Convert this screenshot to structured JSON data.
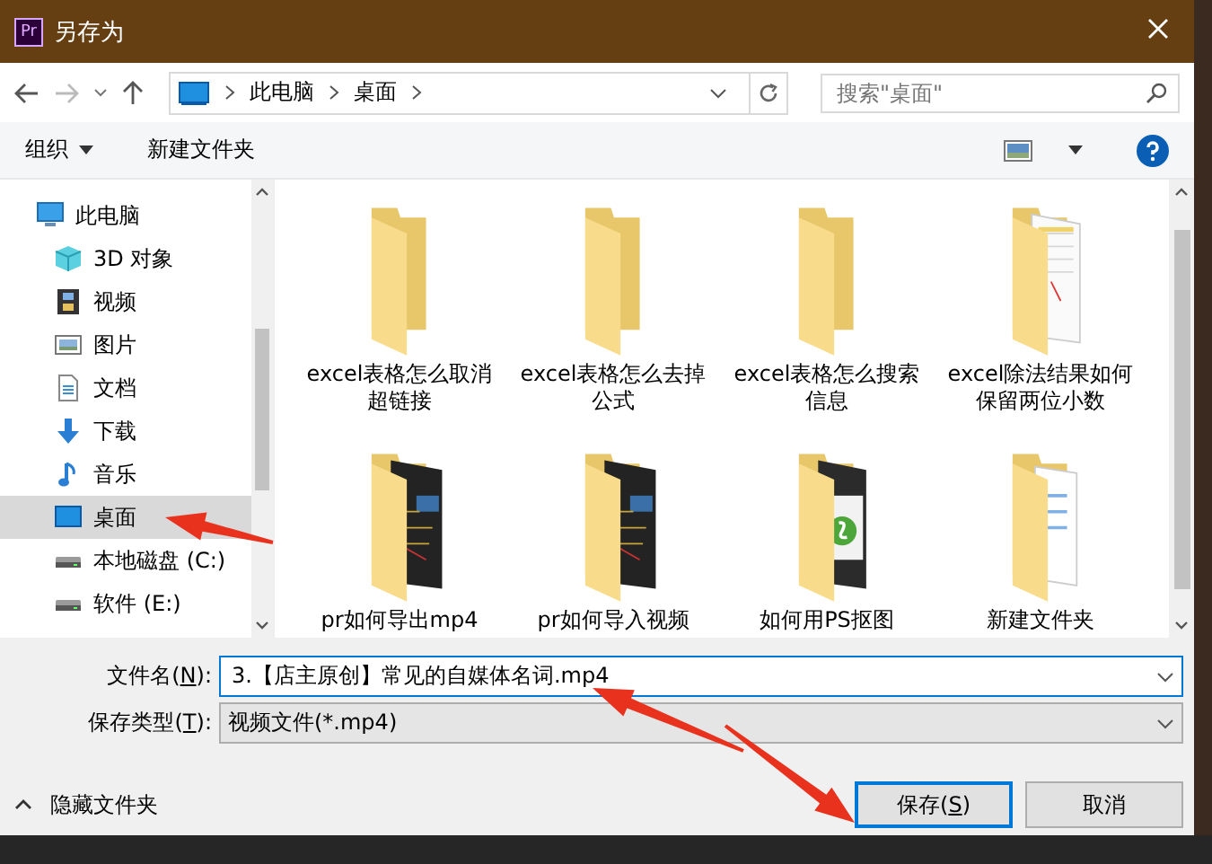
{
  "window": {
    "app_icon": "Pr",
    "title": "另存为"
  },
  "address": {
    "segments": [
      "此电脑",
      "桌面"
    ]
  },
  "search": {
    "placeholder": "搜索\"桌面\""
  },
  "toolbar": {
    "organize": "组织",
    "new_folder": "新建文件夹"
  },
  "sidebar": {
    "items": [
      {
        "label": "此电脑",
        "kind": "pc",
        "selected": false,
        "children": [
          {
            "label": "3D 对象",
            "kind": "cube",
            "selected": false
          },
          {
            "label": "视频",
            "kind": "film",
            "selected": false
          },
          {
            "label": "图片",
            "kind": "picture",
            "selected": false
          },
          {
            "label": "文档",
            "kind": "doc",
            "selected": false
          },
          {
            "label": "下载",
            "kind": "download",
            "selected": false
          },
          {
            "label": "音乐",
            "kind": "music",
            "selected": false
          },
          {
            "label": "桌面",
            "kind": "desktop",
            "selected": true
          },
          {
            "label": "本地磁盘 (C:)",
            "kind": "drive",
            "selected": false
          },
          {
            "label": "软件 (E:)",
            "kind": "drive",
            "selected": false
          }
        ]
      }
    ]
  },
  "files": [
    {
      "name": "excel表格怎么取消超链接",
      "kind": "plain"
    },
    {
      "name": "excel表格怎么去掉公式",
      "kind": "plain"
    },
    {
      "name": "excel表格怎么搜索信息",
      "kind": "plain"
    },
    {
      "name": "excel除法结果如何保留两位小数",
      "kind": "sheet"
    },
    {
      "name": "pr如何导出mp4",
      "kind": "dark"
    },
    {
      "name": "pr如何导入视频",
      "kind": "dark"
    },
    {
      "name": "如何用PS抠图",
      "kind": "green"
    },
    {
      "name": "新建文件夹",
      "kind": "doc"
    }
  ],
  "file_name": {
    "label": "文件名(",
    "access_key": "N",
    "label_end": "):",
    "value": "3.【店主原创】常见的自媒体名词.mp4"
  },
  "save_type": {
    "label": "保存类型(",
    "access_key": "T",
    "label_end": "):",
    "value": "视频文件(*.mp4)"
  },
  "hide_folders": "隐藏文件夹",
  "buttons": [
    {
      "label": "保存(",
      "access_key": "S",
      "label_end": ")",
      "default": true
    },
    {
      "label": "取消",
      "default": false
    }
  ]
}
